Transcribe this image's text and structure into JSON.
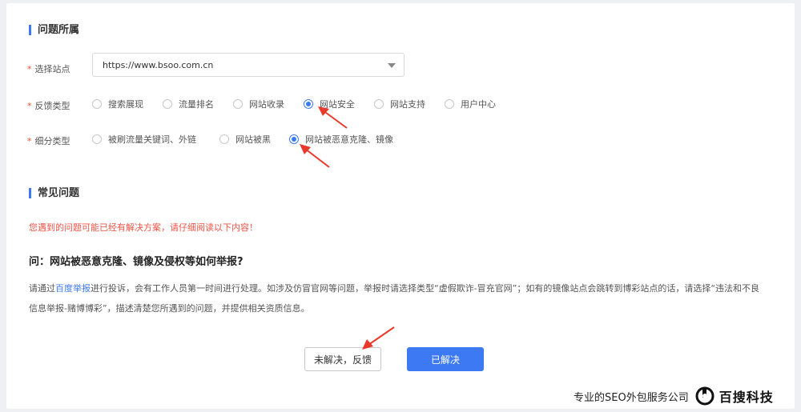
{
  "section1": {
    "title": "问题所属"
  },
  "site": {
    "label": "选择站点",
    "value": "https://www.bsoo.com.cn"
  },
  "feedback_type": {
    "label": "反馈类型",
    "options": [
      "搜索展现",
      "流量排名",
      "网站收录",
      "网站安全",
      "网站支持",
      "用户中心"
    ],
    "selected": "网站安全"
  },
  "sub_type": {
    "label": "细分类型",
    "options": [
      "被刷流量关键词、外链",
      "网站被黑",
      "网站被恶意克隆、镜像"
    ],
    "selected": "网站被恶意克隆、镜像"
  },
  "required_mark": "*",
  "section2": {
    "title": "常见问题"
  },
  "notice": "您遇到的问题可能已经有解决方案，请仔细阅读以下内容！",
  "faq": {
    "question": "问：网站被恶意克隆、镜像及侵权等如何举报?",
    "answer_pre": "请通过",
    "answer_link": "百度举报",
    "answer_post": "进行投诉，会有工作人员第一时间进行处理。如涉及仿冒官网等问题，举报时请选择类型“虚假欺诈-冒充官网”；如有的镜像站点会跳转到博彩站点的话，请选择“违法和不良信息举报-赌博博彩”，描述清楚您所遇到的问题，并提供相关资质信息。"
  },
  "buttons": {
    "unsolved": "未解决，反馈",
    "solved": "已解决"
  },
  "watermark": {
    "text": "专业的SEO外包服务公司",
    "brand": "百搜科技"
  },
  "colors": {
    "accent": "#3d79f2",
    "notice": "#f05345",
    "arrow": "#e8392b"
  }
}
